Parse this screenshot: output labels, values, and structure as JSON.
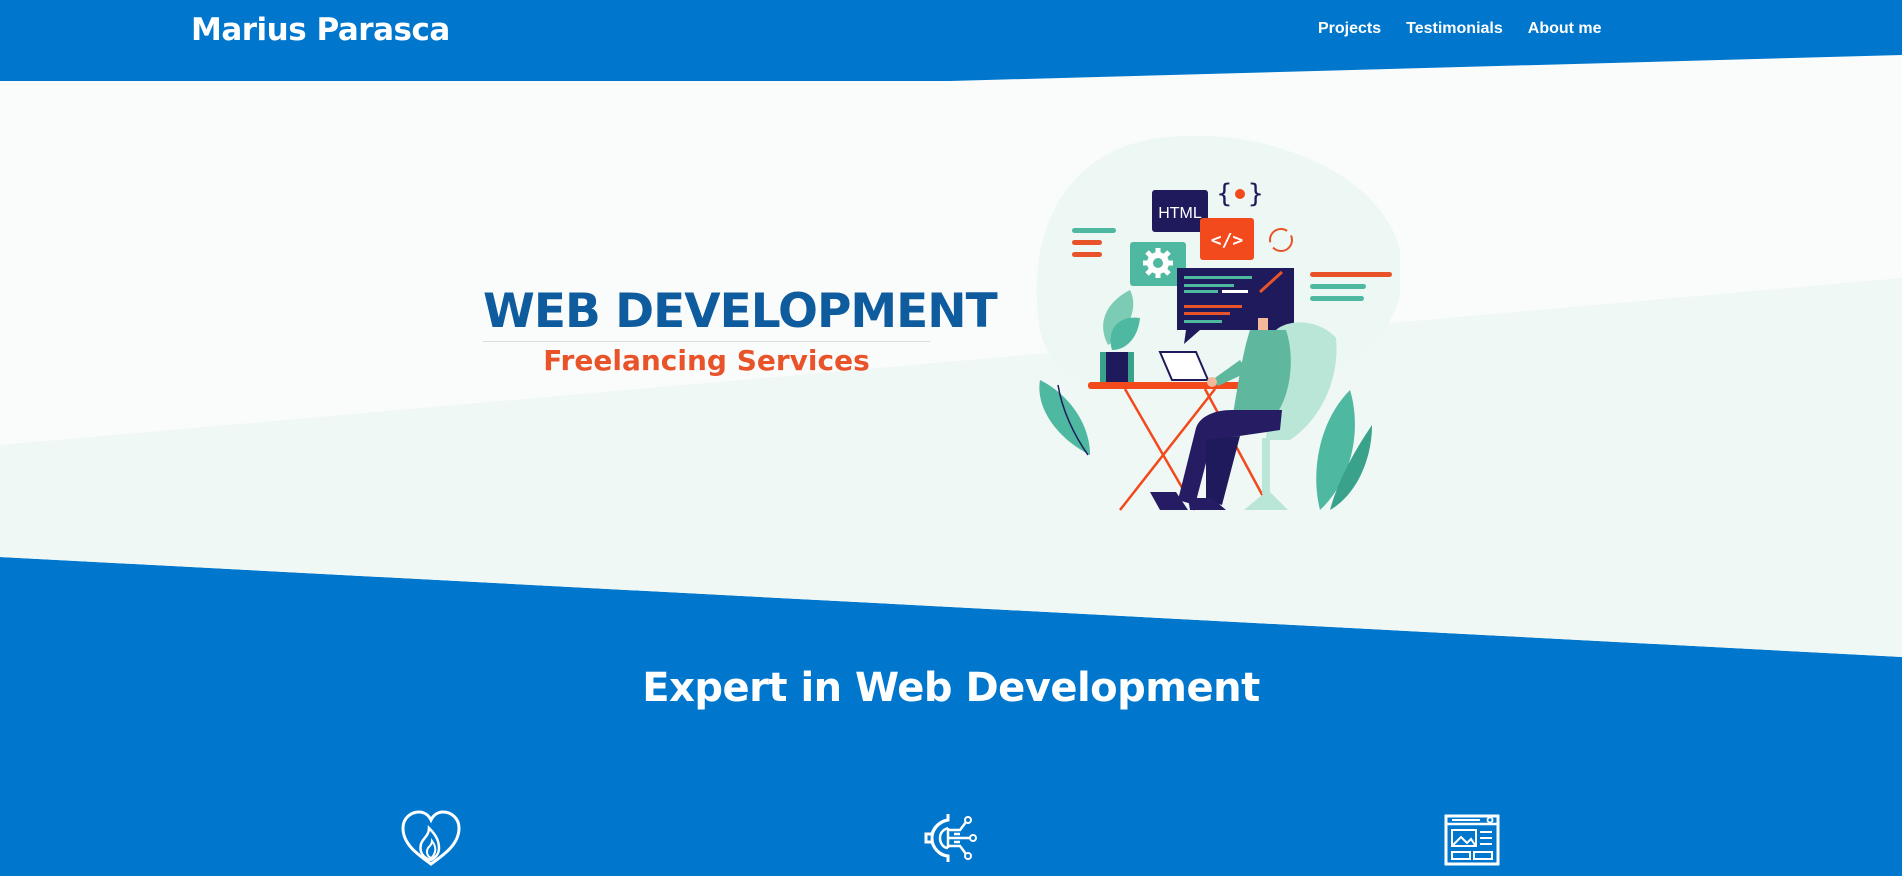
{
  "header": {
    "brand": "Marius Parasca",
    "nav": [
      {
        "label": "Projects"
      },
      {
        "label": "Testimonials"
      },
      {
        "label": "About me"
      }
    ]
  },
  "hero": {
    "title": "WEB DEVELOPMENT",
    "subtitle": "Freelancing Services",
    "illustration": {
      "html_tag": "HTML",
      "code_tag": "</>"
    }
  },
  "section": {
    "title": "Expert in Web Development"
  },
  "features": [
    {
      "icon": "heart-flame-icon"
    },
    {
      "icon": "gear-circuit-icon"
    },
    {
      "icon": "web-layout-icon"
    }
  ],
  "colors": {
    "primary": "#0077cc",
    "hero_title": "#0e5c9e",
    "accent": "#e8532a",
    "teal": "#4fb8a0",
    "navy": "#1f1a5c",
    "light_bg": "#f0f8f5"
  }
}
